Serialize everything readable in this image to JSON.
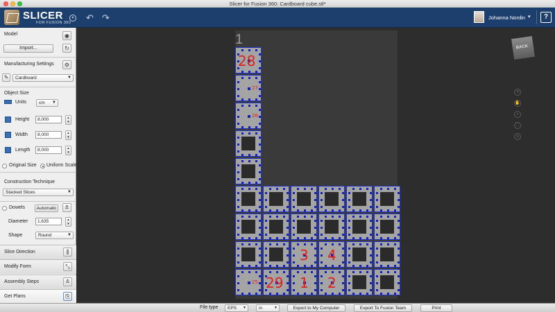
{
  "window": {
    "title": "Slicer for Fusion 360: Cardboard cube.stl*"
  },
  "header": {
    "logo_main": "SLICER",
    "logo_sub": "FOR FUSION 360",
    "user_name": "Johanna Nordin",
    "help_label": "?"
  },
  "sidebar": {
    "model": {
      "title": "Model",
      "import_label": "Import..."
    },
    "manufacturing": {
      "title": "Manufacturing Settings",
      "material": "Cardboard"
    },
    "object_size": {
      "title": "Object Size",
      "units_label": "Units",
      "units_value": "cm",
      "height_label": "Height",
      "height_value": "8,000",
      "width_label": "Width",
      "width_value": "8,000",
      "length_label": "Length",
      "length_value": "8,000",
      "original_size_label": "Original Size",
      "uniform_scale_label": "Uniform Scale"
    },
    "construction": {
      "title": "Construction Technique",
      "value": "Stacked Slices"
    },
    "dowels": {
      "label": "Dowels",
      "mode": "Automatic",
      "diameter_label": "Diameter",
      "diameter_value": "1,635",
      "shape_label": "Shape",
      "shape_value": "Round"
    },
    "folds": [
      {
        "label": "Slice Direction",
        "icon": "slice-direction-icon"
      },
      {
        "label": "Modify Form",
        "icon": "modify-form-icon"
      },
      {
        "label": "Assembly Steps",
        "icon": "assembly-steps-icon"
      },
      {
        "label": "Get Plans",
        "icon": "get-plans-icon"
      }
    ]
  },
  "viewport": {
    "sheet_number": "1",
    "viewcube_label": "BACK",
    "piece_numbers": [
      "28",
      "27",
      "26",
      "29",
      "1",
      "2",
      "3",
      "4",
      "25"
    ]
  },
  "bottombar": {
    "file_type_label": "File type",
    "file_type_value": "EPS",
    "unit_value": "in",
    "export_computer": "Export to My Computer",
    "export_team": "Export To Fusion Team",
    "print": "Print"
  },
  "colors": {
    "header_bg": "#1d3f6e",
    "piece_outline": "#2233cc",
    "piece_label": "#e02020"
  }
}
